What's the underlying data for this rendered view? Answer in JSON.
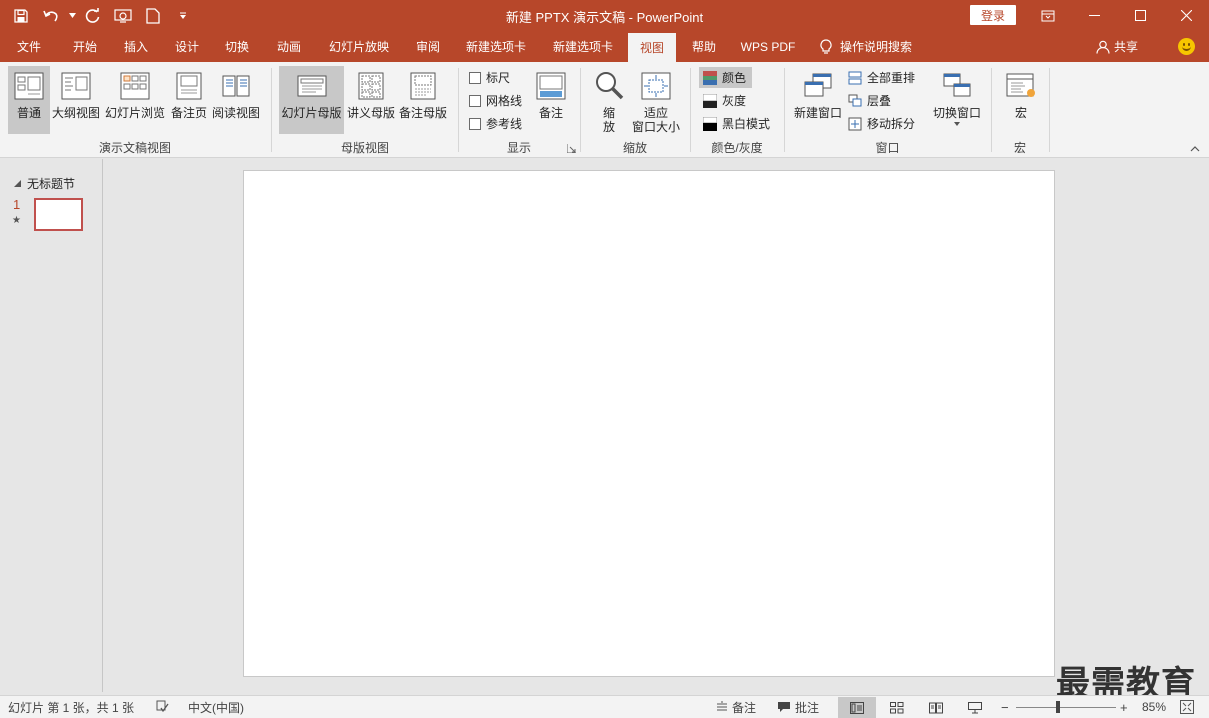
{
  "app": {
    "title": "新建 PPTX 演示文稿 - PowerPoint",
    "login": "登录",
    "accent": "#b7472a"
  },
  "qat": {
    "icons": [
      "save-icon",
      "undo-icon",
      "redo-icon",
      "touch-mode-icon",
      "new-file-icon",
      "customize-icon"
    ]
  },
  "tabs": [
    {
      "label": "文件"
    },
    {
      "label": "开始"
    },
    {
      "label": "插入"
    },
    {
      "label": "设计"
    },
    {
      "label": "切换"
    },
    {
      "label": "动画"
    },
    {
      "label": "幻灯片放映"
    },
    {
      "label": "审阅"
    },
    {
      "label": "新建选项卡"
    },
    {
      "label": "新建选项卡"
    },
    {
      "label": "视图"
    },
    {
      "label": "帮助"
    },
    {
      "label": "WPS PDF"
    }
  ],
  "tellme": "操作说明搜索",
  "share": "共享",
  "ribbon": {
    "presentation_views": {
      "label": "演示文稿视图",
      "buttons": [
        "普通",
        "大纲视图",
        "幻灯片浏览",
        "备注页",
        "阅读视图"
      ]
    },
    "master_views": {
      "label": "母版视图",
      "buttons": [
        "幻灯片母版",
        "讲义母版",
        "备注母版"
      ]
    },
    "show": {
      "label": "显示",
      "checks": [
        "标尺",
        "网格线",
        "参考线"
      ],
      "notes": "备注"
    },
    "zoom": {
      "label": "缩放",
      "zoom_top": "缩",
      "zoom_bottom": "放",
      "fit_top": "适应",
      "fit_bottom": "窗口大小"
    },
    "color": {
      "label": "颜色/灰度",
      "options": [
        "颜色",
        "灰度",
        "黑白模式"
      ]
    },
    "window": {
      "label": "窗口",
      "new_window": "新建窗口",
      "small": [
        "全部重排",
        "层叠",
        "移动拆分"
      ],
      "switch": "切换窗口"
    },
    "macros": {
      "label": "宏",
      "button": "宏"
    }
  },
  "pane": {
    "section": "无标题节",
    "slide_number": "1",
    "star": "★"
  },
  "watermark": "最需教育",
  "status": {
    "slide_info": "幻灯片 第 1 张，共 1 张",
    "language": "中文(中国)",
    "notes": "备注",
    "comments": "批注",
    "zoom_minus": "−",
    "zoom_plus": "+",
    "zoom": "85%",
    "zoom_fraction": 0.42
  }
}
